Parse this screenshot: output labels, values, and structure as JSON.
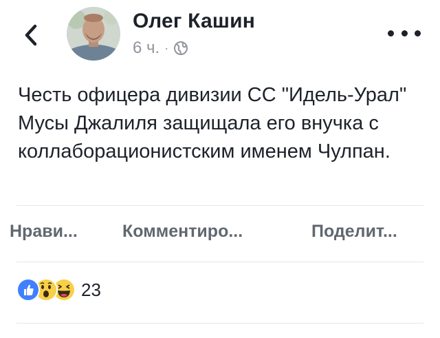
{
  "header": {
    "author_name": "Олег Кашин",
    "time": "6 ч.",
    "separator": "·",
    "icons": {
      "back": "chevron-left-icon",
      "privacy": "globe-icon",
      "more": "more-dots-icon"
    }
  },
  "post": {
    "text": "Честь офицера дивизии СС \"Идель-Урал\" Мусы Джалиля защищала его внучка с коллаборационистским именем Чулпан."
  },
  "actions": {
    "like": "Нрави...",
    "comment": "Комментиро...",
    "share": "Поделит..."
  },
  "reactions": {
    "types": [
      "like",
      "wow",
      "haha"
    ],
    "count": "23"
  },
  "colors": {
    "text": "#1d2129",
    "meta": "#90949c",
    "action": "#616770",
    "like_blue": "#4080ff",
    "reaction_yellow": "#f7d04a",
    "divider": "#e5e6e9"
  }
}
